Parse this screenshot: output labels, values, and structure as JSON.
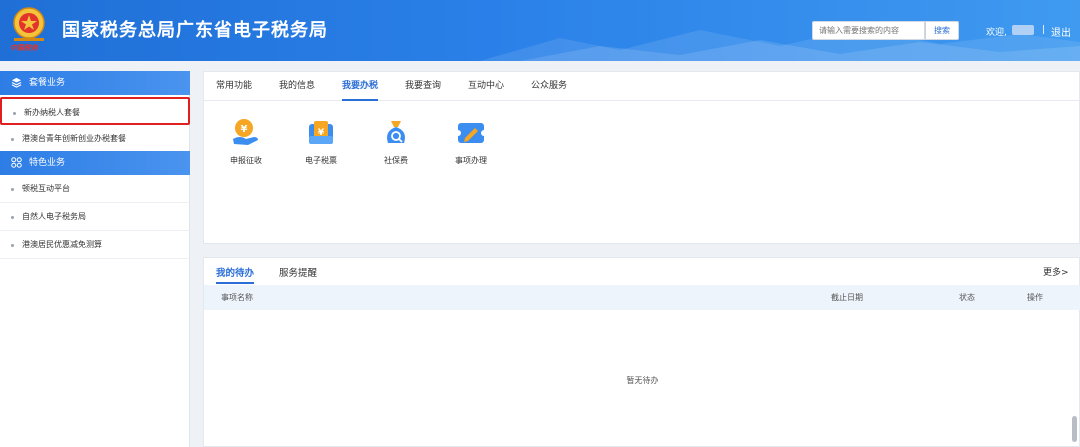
{
  "header": {
    "title": "国家税务总局广东省电子税务局",
    "emblem_caption": "中国税务",
    "search_placeholder": "请输入需要搜索的内容",
    "search_label": "搜索",
    "welcome_label": "欢迎,",
    "separator": "|",
    "logout_label": "退出"
  },
  "sidebar": {
    "groups": [
      {
        "label": "套餐业务",
        "icon": "layers-icon"
      },
      {
        "label": "特色业务",
        "icon": "grid-icon"
      }
    ],
    "package_items": [
      {
        "label": "新办纳税人套餐"
      },
      {
        "label": "港澳台青年创新创业办税套餐"
      }
    ],
    "special_items": [
      {
        "label": "顿税互动平台"
      },
      {
        "label": "自然人电子税务局"
      },
      {
        "label": "港澳居民优惠减免测算"
      }
    ]
  },
  "main": {
    "tabs": [
      {
        "label": "常用功能"
      },
      {
        "label": "我的信息"
      },
      {
        "label": "我要办税"
      },
      {
        "label": "我要查询"
      },
      {
        "label": "互动中心"
      },
      {
        "label": "公众服务"
      }
    ],
    "active_tab": "我要办税",
    "functions": [
      {
        "label": "申报征收",
        "icon": "declare-tax-icon"
      },
      {
        "label": "电子税票",
        "icon": "e-ticket-icon"
      },
      {
        "label": "社保费",
        "icon": "social-security-icon"
      },
      {
        "label": "事项办理",
        "icon": "edit-ticket-icon"
      }
    ]
  },
  "todo": {
    "tabs": [
      {
        "label": "我的待办"
      },
      {
        "label": "服务提醒"
      }
    ],
    "more_label": "更多>",
    "columns": [
      "事项名称",
      "截止日期",
      "状态",
      "操作"
    ],
    "empty_text": "暂无待办"
  },
  "colors": {
    "brand_blue": "#2b6fd6",
    "header_gradient_start": "#1f6fd6",
    "highlight_red": "#e02020"
  }
}
